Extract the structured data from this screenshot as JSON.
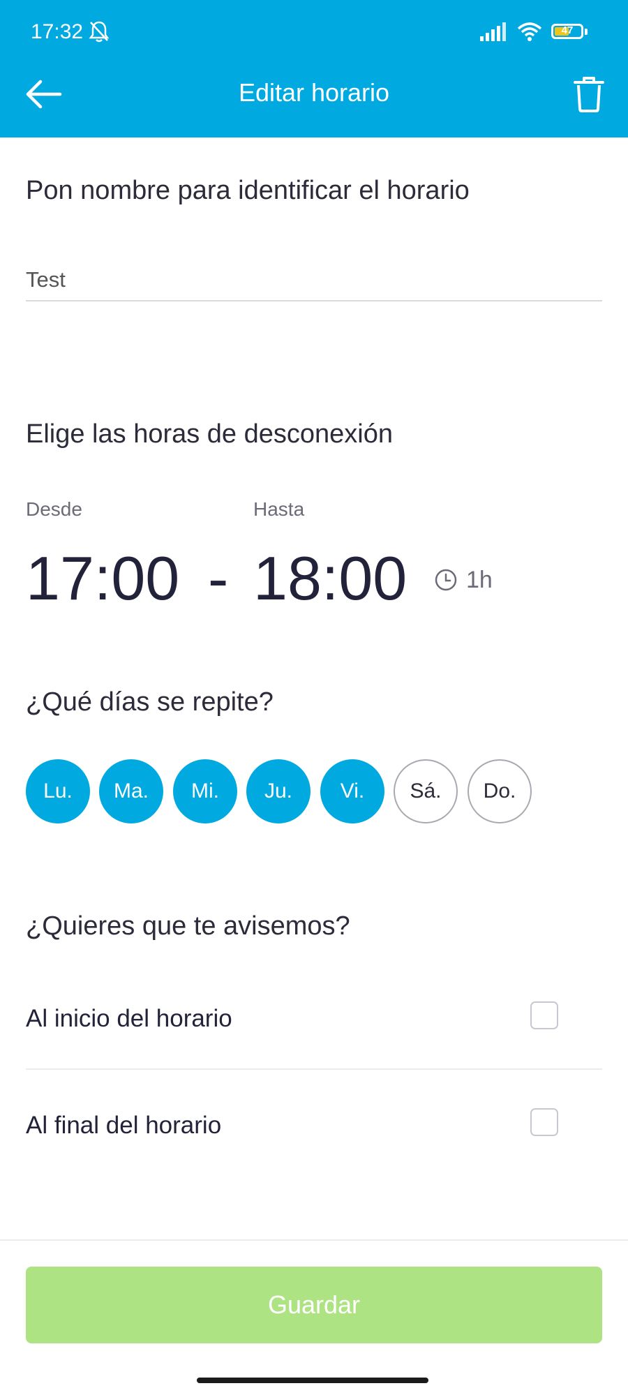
{
  "status_bar": {
    "time": "17:32",
    "battery": "47"
  },
  "header": {
    "title": "Editar horario"
  },
  "name_section": {
    "label": "Pon nombre para identificar el horario",
    "value": "Test"
  },
  "hours_section": {
    "label": "Elige las horas de desconexión",
    "from_label": "Desde",
    "to_label": "Hasta",
    "from_time": "17:00",
    "separator": "-",
    "to_time": "18:00",
    "duration": "1h"
  },
  "days_section": {
    "label": "¿Qué días se repite?",
    "days": [
      {
        "label": "Lu.",
        "selected": true
      },
      {
        "label": "Ma.",
        "selected": true
      },
      {
        "label": "Mi.",
        "selected": true
      },
      {
        "label": "Ju.",
        "selected": true
      },
      {
        "label": "Vi.",
        "selected": true
      },
      {
        "label": "Sá.",
        "selected": false
      },
      {
        "label": "Do.",
        "selected": false
      }
    ]
  },
  "notify_section": {
    "label": "¿Quieres que te avisemos?",
    "options": [
      {
        "label": "Al inicio del horario",
        "checked": false
      },
      {
        "label": "Al final del horario",
        "checked": false
      }
    ]
  },
  "footer": {
    "save_label": "Guardar"
  },
  "colors": {
    "accent": "#00a9e0",
    "save_disabled": "#ade382",
    "text": "#22223a"
  }
}
